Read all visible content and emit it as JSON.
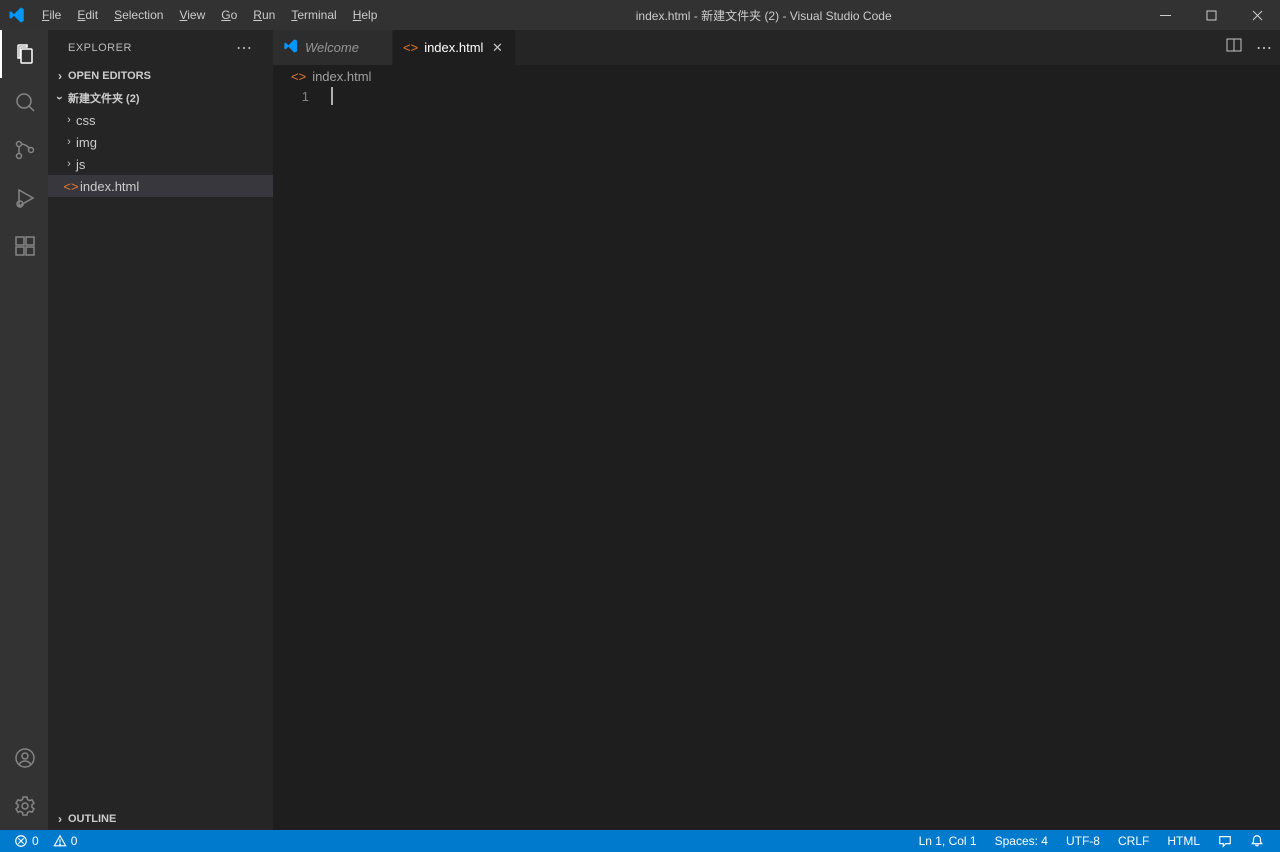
{
  "titlebar": {
    "title": "index.html - 新建文件夹 (2) - Visual Studio Code",
    "menu": [
      "File",
      "Edit",
      "Selection",
      "View",
      "Go",
      "Run",
      "Terminal",
      "Help"
    ]
  },
  "sidebar": {
    "title": "EXPLORER",
    "open_editors_label": "OPEN EDITORS",
    "folder_name": "新建文件夹 (2)",
    "tree": [
      {
        "name": "css",
        "type": "folder"
      },
      {
        "name": "img",
        "type": "folder"
      },
      {
        "name": "js",
        "type": "folder"
      },
      {
        "name": "index.html",
        "type": "file",
        "selected": true
      }
    ],
    "outline_label": "OUTLINE"
  },
  "tabs": [
    {
      "label": "Welcome",
      "icon": "vscode",
      "active": false,
      "italic": true
    },
    {
      "label": "index.html",
      "icon": "html",
      "active": true,
      "italic": false
    }
  ],
  "breadcrumb": {
    "file": "index.html"
  },
  "editor": {
    "line_numbers": [
      "1"
    ]
  },
  "statusbar": {
    "errors": "0",
    "warnings": "0",
    "cursor": "Ln 1, Col 1",
    "spaces": "Spaces: 4",
    "encoding": "UTF-8",
    "eol": "CRLF",
    "lang": "HTML"
  }
}
